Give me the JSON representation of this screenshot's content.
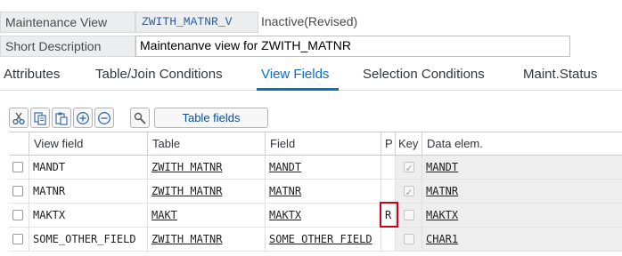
{
  "header": {
    "maintenance_view_label": "Maintenance View",
    "maintenance_view_value": "ZWITH_MATNR_V",
    "status": "Inactive(Revised)",
    "short_description_label": "Short Description",
    "short_description_value": "Maintenanve view for ZWITH_MATNR"
  },
  "tabs": [
    {
      "label": "Attributes"
    },
    {
      "label": "Table/Join Conditions"
    },
    {
      "label": "View Fields",
      "active": true
    },
    {
      "label": "Selection Conditions"
    },
    {
      "label": "Maint.Status"
    }
  ],
  "toolbar": {
    "icons": [
      "cut-icon",
      "copy-icon",
      "paste-icon",
      "insert-row-icon",
      "delete-row-icon",
      "choose-icon"
    ],
    "table_fields_label": "Table fields"
  },
  "columns": {
    "view_field": "View field",
    "table": "Table",
    "field": "Field",
    "p": "P",
    "key": "Key",
    "data_elem": "Data elem."
  },
  "rows": [
    {
      "view_field": "MANDT",
      "table": "ZWITH MATNR",
      "field": "MANDT",
      "p": "",
      "key": true,
      "data_elem": "MANDT"
    },
    {
      "view_field": "MATNR",
      "table": "ZWITH MATNR",
      "field": "MATNR",
      "p": "",
      "key": true,
      "data_elem": "MATNR"
    },
    {
      "view_field": "MAKTX",
      "table": "MAKT",
      "field": "MAKTX",
      "p": "R",
      "key": false,
      "data_elem": "MAKTX"
    },
    {
      "view_field": "SOME_OTHER_FIELD",
      "table": "ZWITH MATNR",
      "field": "SOME OTHER FIELD",
      "p": "",
      "key": false,
      "data_elem": "CHAR1"
    }
  ],
  "colors": {
    "accent": "#0a6ed1",
    "highlight": "#d0021b"
  }
}
